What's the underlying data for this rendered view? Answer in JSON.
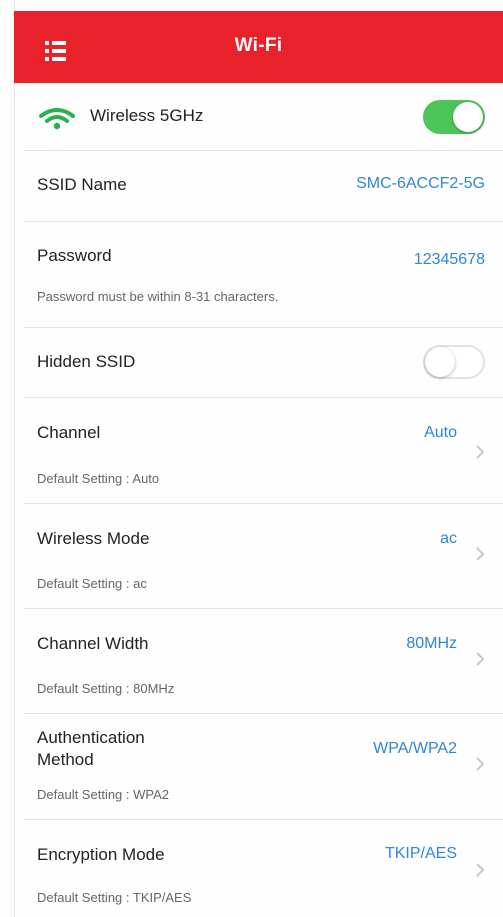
{
  "header": {
    "title": "Wi-Fi",
    "menu_icon": "menu-list-icon",
    "color": "#e8212a"
  },
  "wireless": {
    "label": "Wireless 5GHz",
    "icon": "wifi-icon",
    "enabled": true,
    "icon_color": "#2bb14a",
    "toggle_color": "#4cc65a"
  },
  "ssid": {
    "label": "SSID Name",
    "value": "SMC-6ACCF2-5G"
  },
  "password": {
    "label": "Password",
    "value": "12345678",
    "hint": "Password must be within 8-31 characters."
  },
  "hidden_ssid": {
    "label": "Hidden SSID",
    "enabled": false
  },
  "settings": [
    {
      "label": "Channel",
      "value": "Auto",
      "hint": "Default Setting : Auto"
    },
    {
      "label": "Wireless Mode",
      "value": "ac",
      "hint": "Default Setting : ac"
    },
    {
      "label": "Channel Width",
      "value": "80MHz",
      "hint": "Default Setting : 80MHz"
    },
    {
      "label_line1": "Authentication",
      "label_line2": "Method",
      "value": "WPA/WPA2",
      "hint": "Default Setting : WPA2"
    },
    {
      "label": "Encryption Mode",
      "value": "TKIP/AES",
      "hint": "Default Setting : TKIP/AES"
    }
  ],
  "accent_color": "#2f86d5"
}
